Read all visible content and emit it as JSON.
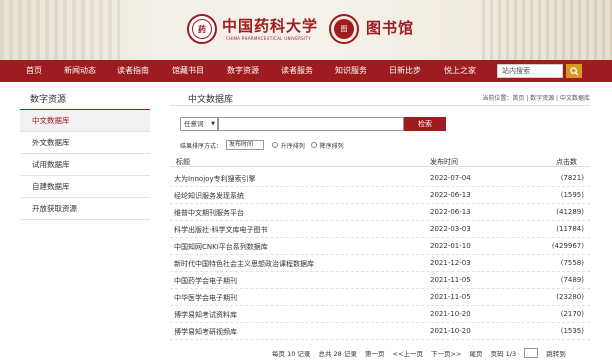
{
  "header": {
    "univ_name": "中国药科大学",
    "univ_name_en": "CHINA PHARMACEUTICAL UNIVERSITY",
    "lib_name": "图书馆"
  },
  "nav": {
    "items": [
      "首页",
      "新闻动态",
      "读者指南",
      "馆藏书目",
      "数字资源",
      "读者服务",
      "知识服务",
      "日新比步",
      "悦上之家"
    ],
    "search_placeholder": "站内搜索"
  },
  "sidebar": {
    "title": "数字资源",
    "items": [
      {
        "label": "中文数据库",
        "active": true
      },
      {
        "label": "外文数据库",
        "active": false
      },
      {
        "label": "试用数据库",
        "active": false
      },
      {
        "label": "自建数据库",
        "active": false
      },
      {
        "label": "开放获取资源",
        "active": false
      }
    ]
  },
  "main": {
    "title": "中文数据库",
    "breadcrumb": "当前位置：首页 | 数字资源 | 中文数据库",
    "search": {
      "field_value": "任意词",
      "button_label": "检索"
    },
    "sort": {
      "label": "结果排序方式：",
      "select_value": "发布时间",
      "asc_label": "升序排列",
      "desc_label": "降序排列"
    },
    "columns": {
      "title": "标题",
      "date": "发布时间",
      "hits": "点击数"
    },
    "rows": [
      {
        "title": "大为Innojoy专利搜索引擎",
        "date": "2022-07-04",
        "hits": "(7821)"
      },
      {
        "title": "经纶知识服务发现系统",
        "date": "2022-06-13",
        "hits": "(1595)"
      },
      {
        "title": "维普中文期刊服务平台",
        "date": "2022-06-13",
        "hits": "(41289)"
      },
      {
        "title": "科学出版社-科学文库电子图书",
        "date": "2022-03-03",
        "hits": "(11784)"
      },
      {
        "title": "中国知网CNKI平台系列数据库",
        "date": "2022-01-10",
        "hits": "(429967)"
      },
      {
        "title": "新时代中国特色社会主义思想政治课程数据库",
        "date": "2021-12-03",
        "hits": "(7558)"
      },
      {
        "title": "中国药学会电子期刊",
        "date": "2021-11-05",
        "hits": "(7489)"
      },
      {
        "title": "中华医学会电子期刊",
        "date": "2021-11-05",
        "hits": "(23280)"
      },
      {
        "title": "博学易知考试资料库",
        "date": "2021-10-20",
        "hits": "(2170)"
      },
      {
        "title": "博学易知考研视频库",
        "date": "2021-10-20",
        "hits": "(1535)"
      }
    ]
  },
  "pager": {
    "per_page": "每页 10 记录",
    "total": "总共 28 记录",
    "first": "第一页",
    "prev": "<<上一页",
    "next": "下一页>>",
    "last": "尾页",
    "page_info": "页码 1/3",
    "jump": "跳转到"
  }
}
